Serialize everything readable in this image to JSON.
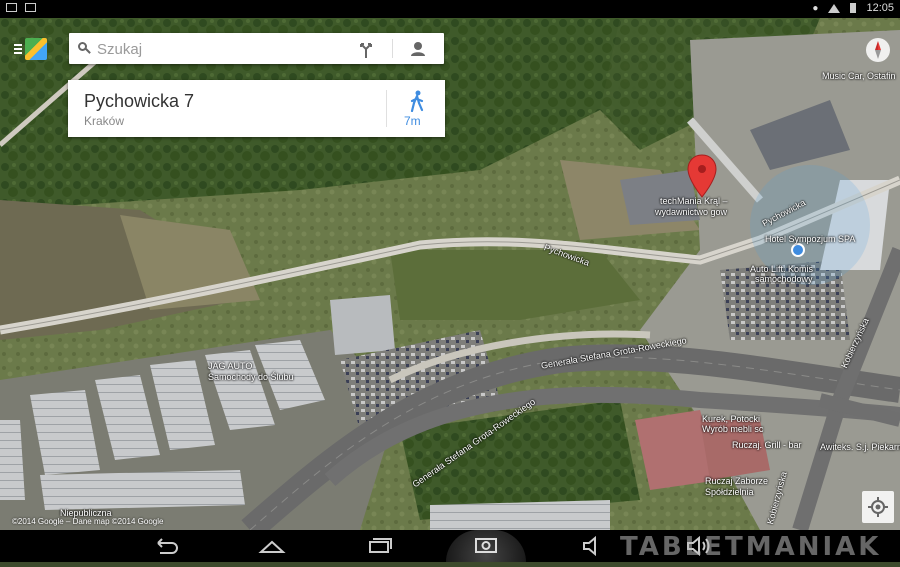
{
  "status_bar": {
    "time": "12:05"
  },
  "search": {
    "placeholder": "Szukaj"
  },
  "place": {
    "name": "Pychowicka 7",
    "city": "Kraków",
    "walk_time": "7m"
  },
  "map_labels": {
    "techmania": "techMania Krąl –",
    "wydawnictwo": "wydawnictwo gow",
    "pychowicka_road": "Pychowicka",
    "pychowicka_road2": "Pychowicka",
    "hotel": "Hotel Sympozjum SPA",
    "auto_lift_1": "Auto Lift. Komis",
    "auto_lift_2": "samochodowy",
    "music_car": "Music Car, Ostafin",
    "jag_auto_1": "JAG AUTO",
    "jag_auto_2": "Samochody do Ślubu",
    "grota_1": "Generała Stefana Grota-Roweckiego",
    "grota_2": "Generała Stefana Grota-Roweckiego",
    "kurek_1": "Kurek, Potocki",
    "kurek_2": "Wyrób mebli sc",
    "ruczaj_grill": "Ruczaj. Grill - bar",
    "ruczaj_z_1": "Ruczaj Zaborze",
    "ruczaj_z_2": "Spółdzielnia",
    "awiteks": "Awiteks. S.j. Piekarn",
    "niepubliczna": "Niepubliczna",
    "kobierzynska": "Kobierzyńska",
    "zawilcowa": "Kobierzyńska"
  },
  "copyright": "©2014 Google – Dane map ©2014 Google",
  "watermark": "TABLETMANIAK",
  "colors": {
    "pin": "#e53935",
    "accent": "#3e8ce0"
  }
}
